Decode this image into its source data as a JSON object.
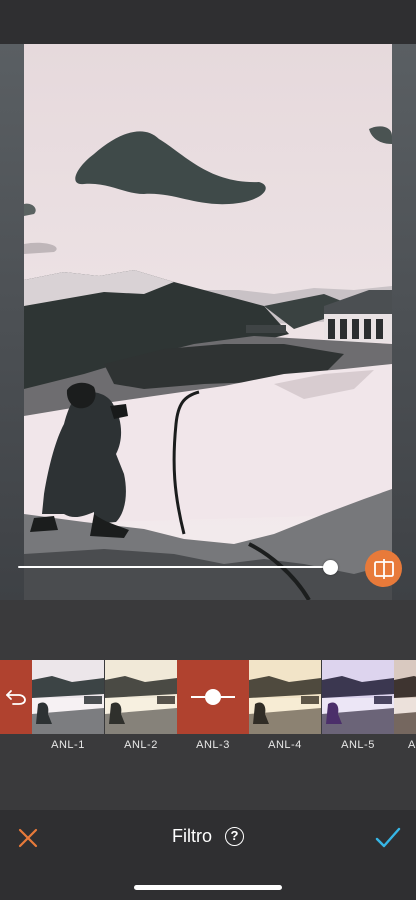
{
  "editor": {
    "title": "Filtro",
    "help_icon_glyph": "?",
    "intensity_level": 0.92
  },
  "filters": {
    "items": [
      {
        "label": "ANL-1",
        "tint": "#e9e2e6"
      },
      {
        "label": "ANL-2",
        "tint": "#efe6d6"
      },
      {
        "label": "ANL-3",
        "tint": "#b0422f",
        "selected": true
      },
      {
        "label": "ANL-4",
        "tint": "#efe2c9"
      },
      {
        "label": "ANL-5",
        "tint": "#d9d0ea"
      },
      {
        "label": "A",
        "tint": "#d8c8c0"
      }
    ]
  },
  "colors": {
    "accent_orange": "#e87a3a",
    "selected_red": "#b0422f",
    "confirm_blue": "#36b6e6"
  },
  "icons": {
    "close": "close-icon",
    "confirm": "checkmark-icon",
    "compare": "compare-icon",
    "undo": "undo-icon",
    "help": "help-icon"
  }
}
